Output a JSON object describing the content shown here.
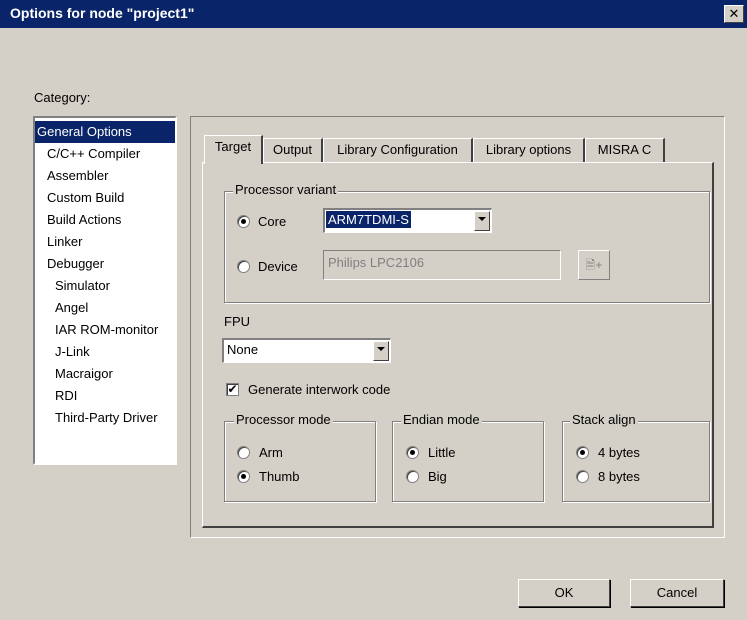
{
  "window": {
    "title": "Options for node \"project1\"",
    "close_glyph": "✕"
  },
  "category": {
    "label": "Category:",
    "items": [
      {
        "label": "General Options",
        "selected": true,
        "sub": false
      },
      {
        "label": "C/C++ Compiler",
        "sub": false
      },
      {
        "label": "Assembler",
        "sub": false
      },
      {
        "label": "Custom Build",
        "sub": false
      },
      {
        "label": "Build Actions",
        "sub": false
      },
      {
        "label": "Linker",
        "sub": false
      },
      {
        "label": "Debugger",
        "sub": false
      },
      {
        "label": "Simulator",
        "sub": true
      },
      {
        "label": "Angel",
        "sub": true
      },
      {
        "label": "IAR ROM-monitor",
        "sub": true
      },
      {
        "label": "J-Link",
        "sub": true
      },
      {
        "label": "Macraigor",
        "sub": true
      },
      {
        "label": "RDI",
        "sub": true
      },
      {
        "label": "Third-Party Driver",
        "sub": true
      }
    ]
  },
  "tabs": [
    "Target",
    "Output",
    "Library Configuration",
    "Library options",
    "MISRA C"
  ],
  "processor_variant": {
    "legend": "Processor variant",
    "core_label": "Core",
    "core_value": "ARM7TDMI-S",
    "device_label": "Device",
    "device_value": "Philips LPC2106",
    "device_button_glyph": "🗎+"
  },
  "fpu": {
    "label": "FPU",
    "value": "None"
  },
  "interwork": {
    "label": "Generate interwork code",
    "checked": true
  },
  "processor_mode": {
    "legend": "Processor mode",
    "options": [
      "Arm",
      "Thumb"
    ],
    "selected": "Thumb"
  },
  "endian_mode": {
    "legend": "Endian mode",
    "options": [
      "Little",
      "Big"
    ],
    "selected": "Little"
  },
  "stack_align": {
    "legend": "Stack align",
    "options": [
      "4 bytes",
      "8 bytes"
    ],
    "selected": "4 bytes"
  },
  "buttons": {
    "ok": "OK",
    "cancel": "Cancel"
  },
  "colors": {
    "titlebar": "#0a246a",
    "face": "#d4d0c8",
    "selection": "#0a246a"
  }
}
